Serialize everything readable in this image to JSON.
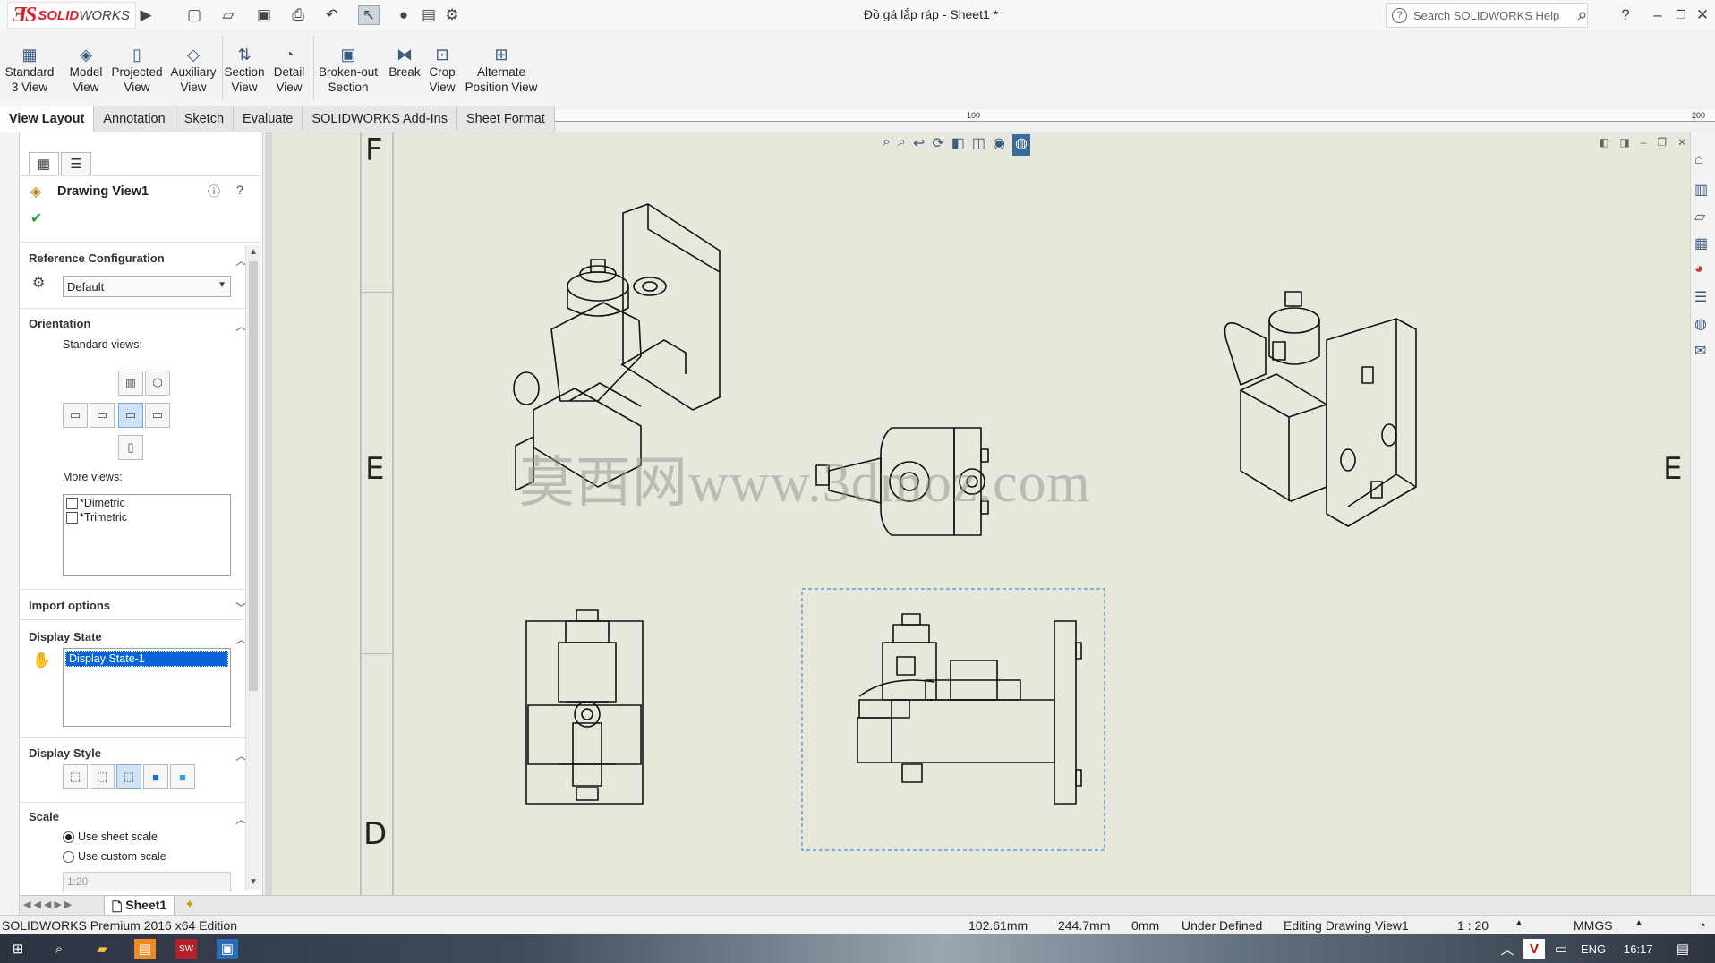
{
  "app": {
    "logo_text": "SOLIDWORKS",
    "doc_title": "Đồ gá lắp ráp - Sheet1 *",
    "search_placeholder": "Search SOLIDWORKS Help"
  },
  "command_manager": {
    "commands": [
      {
        "label": "Standard\n3 View",
        "icon": "standard-3-view-icon"
      },
      {
        "label": "Model\nView",
        "icon": "model-view-icon"
      },
      {
        "label": "Projected\nView",
        "icon": "projected-view-icon"
      },
      {
        "label": "Auxiliary\nView",
        "icon": "auxiliary-view-icon"
      },
      {
        "label": "Section\nView",
        "icon": "section-view-icon"
      },
      {
        "label": "Detail\nView",
        "icon": "detail-view-icon"
      },
      {
        "label": "Broken-out\nSection",
        "icon": "broken-out-section-icon"
      },
      {
        "label": "Break",
        "icon": "break-icon"
      },
      {
        "label": "Crop\nView",
        "icon": "crop-view-icon"
      },
      {
        "label": "Alternate\nPosition View",
        "icon": "alternate-position-view-icon"
      }
    ],
    "tabs": [
      "View Layout",
      "Annotation",
      "Sketch",
      "Evaluate",
      "SOLIDWORKS Add-Ins",
      "Sheet Format"
    ],
    "active_tab": "View Layout"
  },
  "ruler": {
    "labels": [
      "100",
      "200"
    ]
  },
  "property_manager": {
    "title": "Drawing View1",
    "reference_configuration": {
      "heading": "Reference Configuration",
      "value": "Default"
    },
    "orientation": {
      "heading": "Orientation",
      "standard_views_label": "Standard views:",
      "more_views_label": "More views:",
      "more_views": [
        "*Dimetric",
        "*Trimetric"
      ]
    },
    "import_options": {
      "heading": "Import options"
    },
    "display_state": {
      "heading": "Display State",
      "items": [
        "Display State-1"
      ]
    },
    "display_style": {
      "heading": "Display Style"
    },
    "scale": {
      "heading": "Scale",
      "use_sheet_scale": "Use sheet scale",
      "use_custom_scale": "Use custom scale",
      "custom_value": "1:20",
      "selected": "use_sheet_scale"
    }
  },
  "canvas": {
    "zone_labels": {
      "F": "F",
      "E": "E",
      "D": "D",
      "E_right": "E"
    },
    "watermark": "莫西网www.3dmoz.com"
  },
  "sheet_tabs": {
    "active": "Sheet1"
  },
  "status": {
    "edition": "SOLIDWORKS Premium 2016 x64 Edition",
    "x": "102.61mm",
    "y": "244.7mm",
    "z": "0mm",
    "definition": "Under Defined",
    "editing": "Editing Drawing View1",
    "scale": "1 : 20",
    "units": "MMGS"
  },
  "taskbar": {
    "language": "ENG",
    "time": "16:17"
  },
  "colors": {
    "canvas_bg": "#e7e8db",
    "selection_blue": "#0a64d8",
    "logo_red": "#d9232a"
  }
}
